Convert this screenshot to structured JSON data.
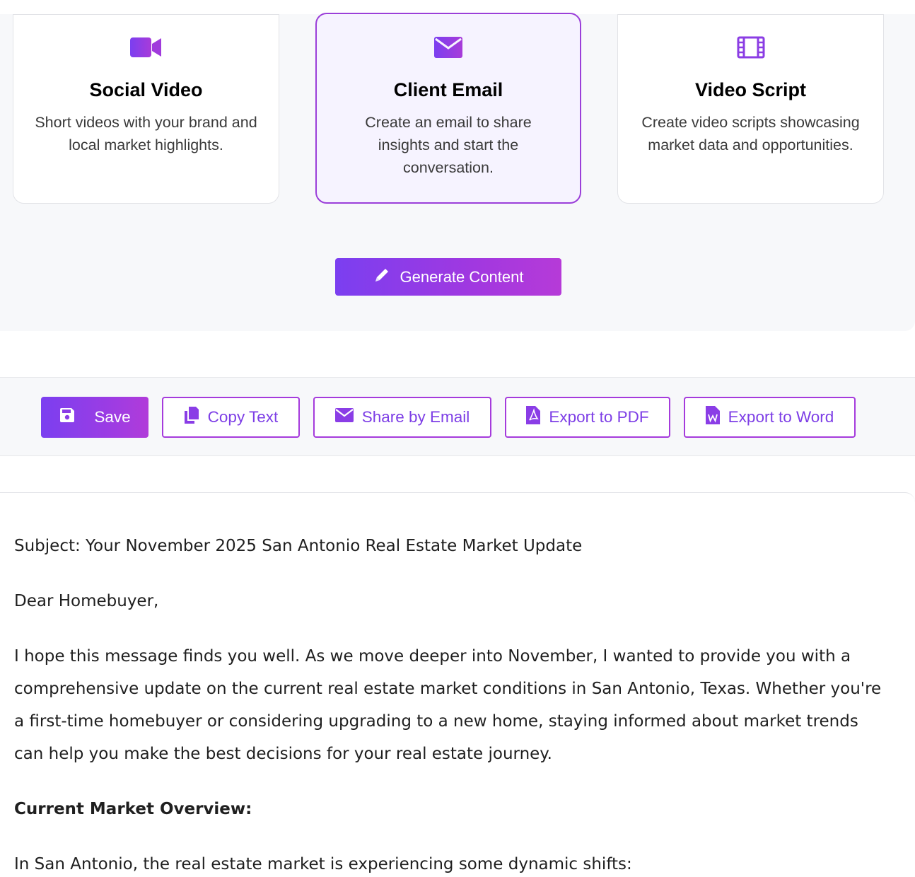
{
  "cards": [
    {
      "title": "Social Video",
      "description": "Short videos with your brand and local market highlights.",
      "icon": "video-camera-icon",
      "selected": false
    },
    {
      "title": "Client Email",
      "description": "Create an email to share insights and start the conversation.",
      "icon": "envelope-icon",
      "selected": true
    },
    {
      "title": "Video Script",
      "description": "Create video scripts showcasing market data and opportunities.",
      "icon": "film-icon",
      "selected": false
    }
  ],
  "generate_button": {
    "label": "Generate Content",
    "icon": "pencil-icon"
  },
  "toolbar": {
    "save": {
      "label": "Save",
      "icon": "floppy-disk-icon"
    },
    "copy": {
      "label": "Copy Text",
      "icon": "copy-icon"
    },
    "share": {
      "label": "Share by Email",
      "icon": "envelope-icon"
    },
    "pdf": {
      "label": "Export to PDF",
      "icon": "pdf-file-icon"
    },
    "word": {
      "label": "Export to Word",
      "icon": "word-file-icon"
    }
  },
  "email": {
    "subject": "Subject: Your November 2025 San Antonio Real Estate Market Update",
    "greeting": "Dear Homebuyer,",
    "intro": "I hope this message finds you well. As we move deeper into November, I wanted to provide you with a comprehensive update on the current real estate market conditions in San Antonio, Texas. Whether you're a first-time homebuyer or considering upgrading to a new home, staying informed about market trends can help you make the best decisions for your real estate journey.",
    "section_heading": "Current Market Overview:",
    "section_intro": "In San Antonio, the real estate market is experiencing some dynamic shifts:"
  },
  "colors": {
    "accent": "#8a3de6",
    "accent_start": "#7b3ff0",
    "accent_end": "#b63ad8",
    "panel_bg": "#f7f8fa"
  }
}
